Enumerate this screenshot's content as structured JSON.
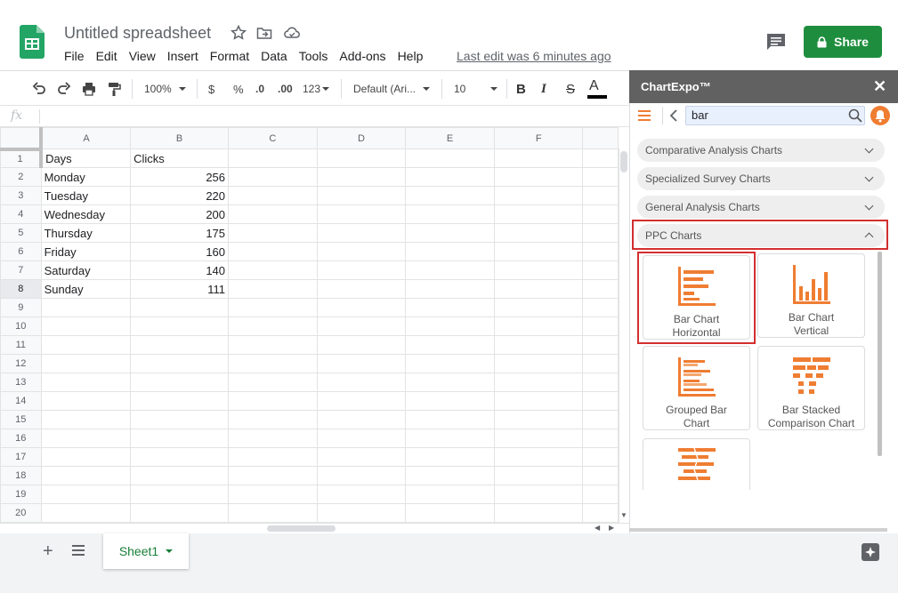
{
  "app": {
    "title": "Untitled spreadsheet",
    "menu": [
      "File",
      "Edit",
      "View",
      "Insert",
      "Format",
      "Data",
      "Tools",
      "Add-ons",
      "Help"
    ],
    "last_edit": "Last edit was 6 minutes ago",
    "share_label": "Share",
    "accent_color": "#1e8e3e"
  },
  "toolbar": {
    "zoom": "100%",
    "currency": "$",
    "percent": "%",
    "dec_less": ".0",
    "dec_more": ".00",
    "number_format": "123",
    "font": "Default (Ari...",
    "font_size": "10",
    "bold": "B",
    "italic": "I",
    "strike": "S",
    "text_color": "A"
  },
  "formula_bar": {
    "fx": "fx",
    "value": ""
  },
  "sheet": {
    "columns": [
      "A",
      "B",
      "C",
      "D",
      "E",
      "F"
    ],
    "rows": [
      {
        "n": "1",
        "a": "Days",
        "b": "Clicks"
      },
      {
        "n": "2",
        "a": "Monday",
        "b": "256"
      },
      {
        "n": "3",
        "a": "Tuesday",
        "b": "220"
      },
      {
        "n": "4",
        "a": "Wednesday",
        "b": "200"
      },
      {
        "n": "5",
        "a": "Thursday",
        "b": "175"
      },
      {
        "n": "6",
        "a": "Friday",
        "b": "160"
      },
      {
        "n": "7",
        "a": "Saturday",
        "b": "140"
      },
      {
        "n": "8",
        "a": "Sunday",
        "b": "111"
      },
      {
        "n": "9",
        "a": "",
        "b": ""
      },
      {
        "n": "10",
        "a": "",
        "b": ""
      },
      {
        "n": "11",
        "a": "",
        "b": ""
      },
      {
        "n": "12",
        "a": "",
        "b": ""
      },
      {
        "n": "13",
        "a": "",
        "b": ""
      },
      {
        "n": "14",
        "a": "",
        "b": ""
      },
      {
        "n": "15",
        "a": "",
        "b": ""
      },
      {
        "n": "16",
        "a": "",
        "b": ""
      },
      {
        "n": "17",
        "a": "",
        "b": ""
      },
      {
        "n": "18",
        "a": "",
        "b": ""
      },
      {
        "n": "19",
        "a": "",
        "b": ""
      },
      {
        "n": "20",
        "a": "",
        "b": ""
      }
    ],
    "tab_name": "Sheet1"
  },
  "panel": {
    "title": "ChartExpo™",
    "search_value": "bar",
    "brand_color": "#ef7d32",
    "categories": [
      {
        "label": "Comparative Analysis Charts",
        "expanded": false
      },
      {
        "label": "Specialized Survey Charts",
        "expanded": false
      },
      {
        "label": "General Analysis Charts",
        "expanded": false
      },
      {
        "label": "PPC Charts",
        "expanded": true
      }
    ],
    "charts": [
      {
        "line1": "Bar Chart",
        "line2": "Horizontal",
        "icon": "bar-horizontal-icon"
      },
      {
        "line1": "Bar Chart",
        "line2": "Vertical",
        "icon": "bar-vertical-icon"
      },
      {
        "line1": "Grouped Bar",
        "line2": "Chart",
        "icon": "grouped-bar-icon"
      },
      {
        "line1": "Bar Stacked",
        "line2": "Comparison Chart",
        "icon": "bar-stacked-icon"
      }
    ]
  }
}
